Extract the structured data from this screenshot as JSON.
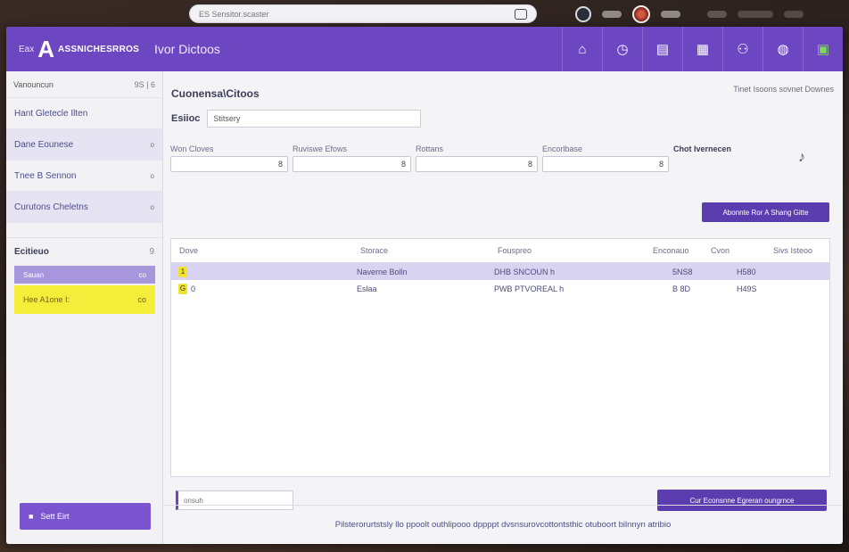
{
  "os": {
    "url": "ES  Sensitor.scaster"
  },
  "header": {
    "logo_mini": "Eax",
    "logo_glyph": "A",
    "app_name": "ASSNICHESRROS",
    "section": "Ivor Dictoos",
    "icons": [
      "home-icon",
      "clock-icon",
      "list-icon",
      "grid-icon",
      "users-icon",
      "chat-icon",
      "apps-icon"
    ]
  },
  "sidebar": {
    "head": {
      "label": "Vanouncun",
      "count": "9S | 6"
    },
    "items": [
      {
        "label": "Hant Gletecle Ilten",
        "badge": ""
      },
      {
        "label": "Dane Eounese",
        "badge": "o"
      },
      {
        "label": "Tnee B Sennon",
        "badge": "o"
      },
      {
        "label": "Curutons Cheletns",
        "badge": "o"
      }
    ],
    "section": {
      "label": "Ecitieuo",
      "badge": "9"
    },
    "sub_items": [
      {
        "label": "Sauan",
        "badge": "co"
      },
      {
        "label": "Hee A1one I:",
        "badge": "co"
      }
    ],
    "button_label": "Sett Eirt"
  },
  "main": {
    "title": "Cuonensa\\Citoos",
    "top_link": "Tinet Isoons sovnet Downes",
    "search": {
      "label": "Esiioc",
      "value": "Stitsery"
    },
    "filters": [
      {
        "label": "Won Cloves",
        "value": "8"
      },
      {
        "label": "Ruviswe Efows",
        "value": "8"
      },
      {
        "label": "Rottans",
        "value": "8"
      },
      {
        "label": "Encorlbase",
        "value": "8"
      }
    ],
    "clear_label": "Chot Ivernecen",
    "action_button": "Abonnte Ror A Shang Gitte",
    "table": {
      "headers": [
        "Dove",
        "Storace",
        "Fouspreo",
        "Enconauo",
        "Cvon",
        "Sivs Isteoo"
      ],
      "rows": [
        {
          "icon": "1",
          "c1": "",
          "c2": "Naverne Bolln",
          "c3": "DHB SNCOUN h",
          "c4": "5NS8",
          "c5": "H580",
          "selected": true
        },
        {
          "icon": "G",
          "c1": "0",
          "c2": "Eslaa",
          "c3": "PWB PTVOREAL h",
          "c4": "B 8D",
          "c5": "H49S",
          "selected": false
        }
      ]
    },
    "pager_placeholder": "onsuh",
    "bottom_button": "Cur Econsnne Egreran oungrnce",
    "footer": "Pilsterorurtstsly llo ppoolt outhlipooo dppppt dvsnsurovcottontsthic otuboort bilnnyn atribio"
  },
  "colors": {
    "brand": "#6d46c2",
    "highlight": "#f4ee3a",
    "button": "#5b3db0"
  }
}
